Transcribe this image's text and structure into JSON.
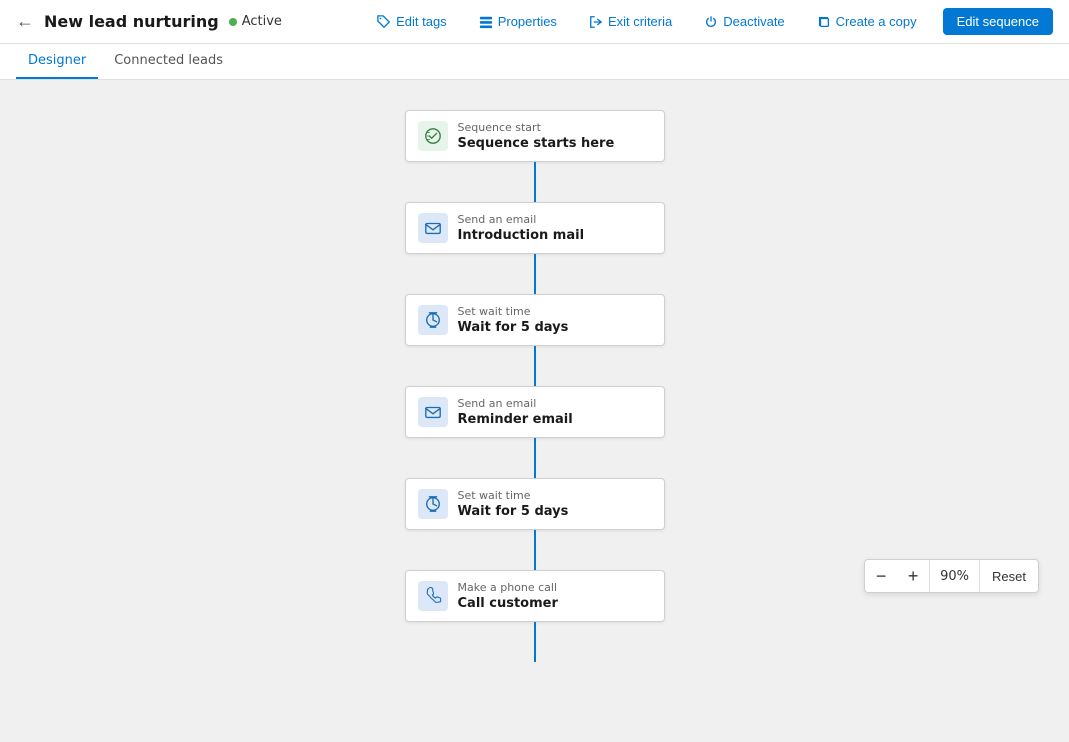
{
  "header": {
    "back_label": "←",
    "title": "New lead nurturing",
    "status": "Active",
    "actions": [
      {
        "id": "edit-tags",
        "label": "Edit tags",
        "icon": "tag"
      },
      {
        "id": "properties",
        "label": "Properties",
        "icon": "properties"
      },
      {
        "id": "exit-criteria",
        "label": "Exit criteria",
        "icon": "exit"
      },
      {
        "id": "deactivate",
        "label": "Deactivate",
        "icon": "power"
      },
      {
        "id": "create-copy",
        "label": "Create a copy",
        "icon": "copy"
      }
    ],
    "edit_btn_label": "Edit sequence"
  },
  "tabs": [
    {
      "id": "designer",
      "label": "Designer",
      "active": true
    },
    {
      "id": "connected-leads",
      "label": "Connected leads",
      "active": false
    }
  ],
  "flow": {
    "nodes": [
      {
        "id": "start",
        "icon_type": "green",
        "icon": "⚙",
        "label": "Sequence start",
        "title": "Sequence starts here"
      },
      {
        "id": "email1",
        "icon_type": "blue",
        "icon": "✉",
        "label": "Send an email",
        "title": "Introduction mail"
      },
      {
        "id": "wait1",
        "icon_type": "blue",
        "icon": "⏳",
        "label": "Set wait time",
        "title": "Wait for 5 days"
      },
      {
        "id": "email2",
        "icon_type": "blue",
        "icon": "✉",
        "label": "Send an email",
        "title": "Reminder email"
      },
      {
        "id": "wait2",
        "icon_type": "blue",
        "icon": "⏳",
        "label": "Set wait time",
        "title": "Wait for 5 days"
      },
      {
        "id": "call",
        "icon_type": "blue",
        "icon": "📞",
        "label": "Make a phone call",
        "title": "Call customer"
      }
    ]
  },
  "zoom": {
    "value": "90%",
    "minus_label": "−",
    "plus_label": "+",
    "reset_label": "Reset"
  }
}
